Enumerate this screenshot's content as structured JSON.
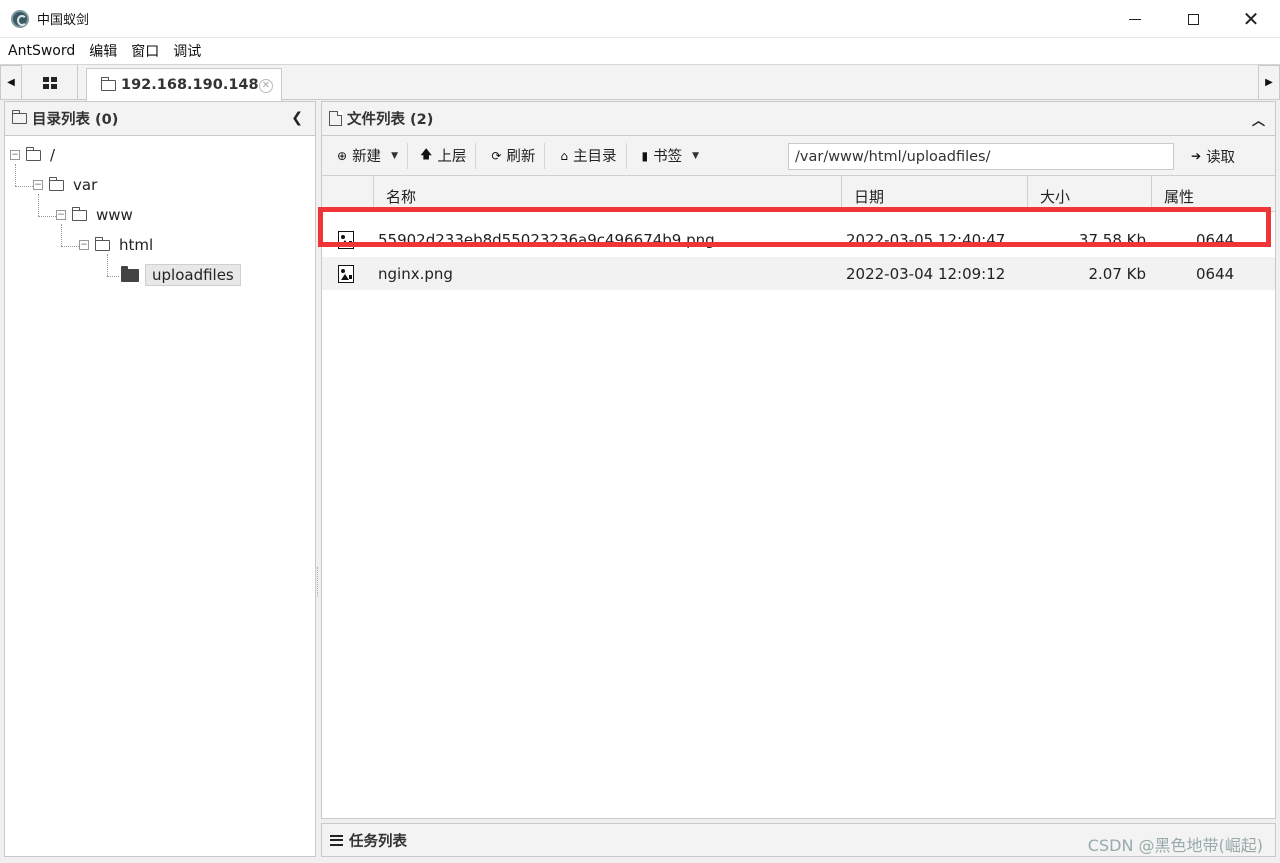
{
  "window": {
    "title": "中国蚁剑",
    "controls": {
      "minimize": "minimize",
      "maximize": "maximize",
      "close": "✕"
    }
  },
  "menu": {
    "items": [
      "AntSword",
      "编辑",
      "窗口",
      "调试"
    ]
  },
  "tabs": {
    "active_label": "192.168.190.148",
    "close_glyph": "✕"
  },
  "dir_panel": {
    "title": "目录列表 (0)",
    "tree": [
      {
        "label": "/",
        "toggle": "−"
      },
      {
        "label": "var",
        "toggle": "−"
      },
      {
        "label": "www",
        "toggle": "−"
      },
      {
        "label": "html",
        "toggle": "−"
      },
      {
        "label": "uploadfiles",
        "selected": true
      }
    ]
  },
  "file_panel": {
    "title": "文件列表 (2)",
    "toolbar": {
      "new_label": "新建",
      "up_label": "上层",
      "refresh_label": "刷新",
      "home_label": "主目录",
      "bookmark_label": "书签",
      "path_value": "/var/www/html/uploadfiles/",
      "read_label": "读取"
    },
    "columns": [
      "名称",
      "日期",
      "大小",
      "属性"
    ],
    "rows": [
      {
        "name": "55902d233eb8d55023236a9c496674b9.png",
        "date": "2022-03-05 12:40:47",
        "size": "37.58 Kb",
        "attr": "0644",
        "highlighted": true
      },
      {
        "name": "nginx.png",
        "date": "2022-03-04 12:09:12",
        "size": "2.07 Kb",
        "attr": "0644"
      }
    ]
  },
  "task_panel": {
    "title": "任务列表"
  },
  "watermark": "CSDN @黑色地带(崛起)",
  "colors": {
    "highlight_border": "#ef3535",
    "panel_bg": "#f3f3f3"
  }
}
